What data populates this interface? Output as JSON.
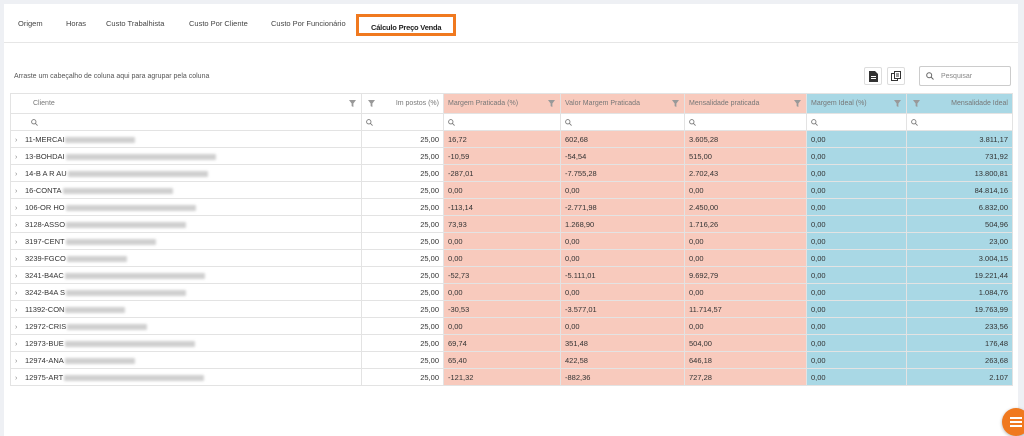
{
  "tabs": [
    {
      "label": "Origem"
    },
    {
      "label": "Horas"
    },
    {
      "label": "Custo Trabalhista"
    },
    {
      "label": "Custo Por Cliente"
    },
    {
      "label": "Custo Por Funcionário"
    },
    {
      "label": "Cálculo Preço Venda",
      "active": true
    }
  ],
  "toolbar": {
    "group_hint": "Arraste um cabeçalho de coluna aqui para agrupar pela coluna",
    "search_placeholder": "Pesquisar",
    "export_pdf_icon": "file-pdf-icon",
    "column_chooser_icon": "column-chooser-icon"
  },
  "colors": {
    "accent": "#f0791f",
    "red_cols": "#f8cabd",
    "blue_cols": "#a9d8e5"
  },
  "grid": {
    "columns": {
      "cliente": "Cliente",
      "impostos": "Im postos (%)",
      "margem_praticada": "Margem Praticada (%)",
      "valor_margem_praticada": "Valor Margem Praticada",
      "mensalidade_praticada": "Mensalidade praticada",
      "margem_ideal": "Margem Ideal (%)",
      "mensalidade_ideal": "Mensalidade Ideal"
    },
    "rows": [
      {
        "cliente": "11-MERCAI",
        "impostos": "25,00",
        "mp": "16,72",
        "vmp": "602,68",
        "mens": "3.605,28",
        "mi": "0,00",
        "mensi": "3.811,17"
      },
      {
        "cliente": "13-BOHDAI",
        "impostos": "25,00",
        "mp": "-10,59",
        "vmp": "-54,54",
        "mens": "515,00",
        "mi": "0,00",
        "mensi": "731,92"
      },
      {
        "cliente": "14-B A R AU",
        "impostos": "25,00",
        "mp": "-287,01",
        "vmp": "-7.755,28",
        "mens": "2.702,43",
        "mi": "0,00",
        "mensi": "13.800,81"
      },
      {
        "cliente": "16-CONTA",
        "impostos": "25,00",
        "mp": "0,00",
        "vmp": "0,00",
        "mens": "0,00",
        "mi": "0,00",
        "mensi": "84.814,16"
      },
      {
        "cliente": "106-OR HO",
        "impostos": "25,00",
        "mp": "-113,14",
        "vmp": "-2.771,98",
        "mens": "2.450,00",
        "mi": "0,00",
        "mensi": "6.832,00"
      },
      {
        "cliente": "3128-ASSO",
        "impostos": "25,00",
        "mp": "73,93",
        "vmp": "1.268,90",
        "mens": "1.716,26",
        "mi": "0,00",
        "mensi": "504,96"
      },
      {
        "cliente": "3197-CENT",
        "impostos": "25,00",
        "mp": "0,00",
        "vmp": "0,00",
        "mens": "0,00",
        "mi": "0,00",
        "mensi": "23,00"
      },
      {
        "cliente": "3239-FGCO",
        "impostos": "25,00",
        "mp": "0,00",
        "vmp": "0,00",
        "mens": "0,00",
        "mi": "0,00",
        "mensi": "3.004,15"
      },
      {
        "cliente": "3241-B4AC",
        "impostos": "25,00",
        "mp": "-52,73",
        "vmp": "-5.111,01",
        "mens": "9.692,79",
        "mi": "0,00",
        "mensi": "19.221,44"
      },
      {
        "cliente": "3242-B4A S",
        "impostos": "25,00",
        "mp": "0,00",
        "vmp": "0,00",
        "mens": "0,00",
        "mi": "0,00",
        "mensi": "1.084,76"
      },
      {
        "cliente": "11392-CON",
        "impostos": "25,00",
        "mp": "-30,53",
        "vmp": "-3.577,01",
        "mens": "11.714,57",
        "mi": "0,00",
        "mensi": "19.763,99"
      },
      {
        "cliente": "12972-CRIS",
        "impostos": "25,00",
        "mp": "0,00",
        "vmp": "0,00",
        "mens": "0,00",
        "mi": "0,00",
        "mensi": "233,56"
      },
      {
        "cliente": "12973-BUE",
        "impostos": "25,00",
        "mp": "69,74",
        "vmp": "351,48",
        "mens": "504,00",
        "mi": "0,00",
        "mensi": "176,48"
      },
      {
        "cliente": "12974-ANA",
        "impostos": "25,00",
        "mp": "65,40",
        "vmp": "422,58",
        "mens": "646,18",
        "mi": "0,00",
        "mensi": "263,68"
      },
      {
        "cliente": "12975-ART",
        "impostos": "25,00",
        "mp": "-121,32",
        "vmp": "-882,36",
        "mens": "727,28",
        "mi": "0,00",
        "mensi": "2.107"
      }
    ]
  },
  "fab": {
    "icon": "menu-icon"
  }
}
